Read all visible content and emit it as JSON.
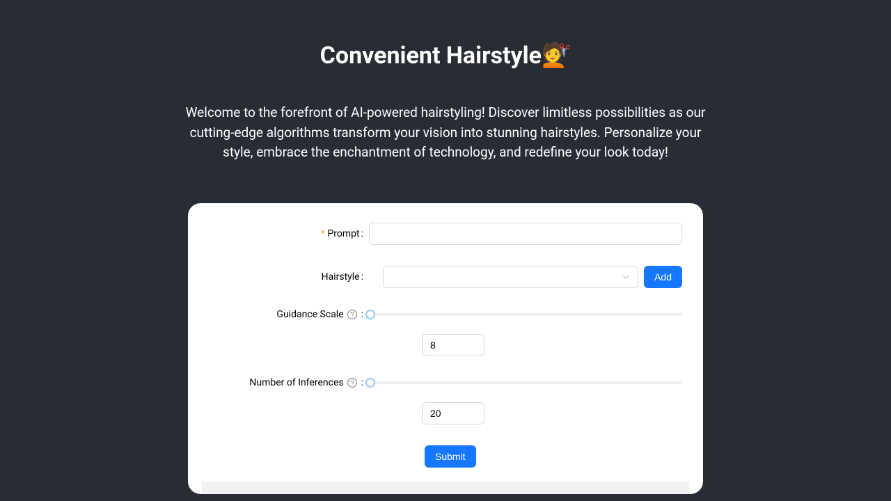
{
  "header": {
    "title": "Convenient Hairstyle💇"
  },
  "description": "Welcome to the forefront of AI-powered hairstyling! Discover limitless possibilities as our cutting-edge algorithms transform your vision into stunning hairstyles. Personalize your style, embrace the enchantment of technology, and redefine your look today!",
  "form": {
    "prompt": {
      "label": "Prompt",
      "value": ""
    },
    "hairstyle": {
      "label": "Hairstyle",
      "value": "",
      "add_label": "Add"
    },
    "guidance_scale": {
      "label": "Guidance Scale",
      "value": "8"
    },
    "num_inferences": {
      "label": "Number of Inferences",
      "value": "20"
    },
    "submit_label": "Submit"
  }
}
